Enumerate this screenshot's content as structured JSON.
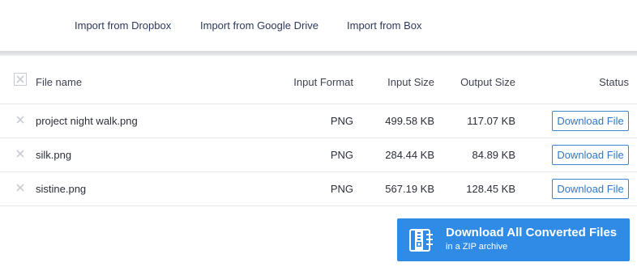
{
  "imports": {
    "dropbox": "Import from Dropbox",
    "gdrive": "Import from Google Drive",
    "box": "Import from Box"
  },
  "table": {
    "headers": {
      "file_name": "File name",
      "input_format": "Input Format",
      "input_size": "Input Size",
      "output_size": "Output Size",
      "status": "Status"
    },
    "rows": [
      {
        "name": "project night walk.png",
        "format": "PNG",
        "input_size": "499.58 KB",
        "output_size": "117.07 KB",
        "action": "Download File"
      },
      {
        "name": "silk.png",
        "format": "PNG",
        "input_size": "284.44 KB",
        "output_size": "84.89 KB",
        "action": "Download File"
      },
      {
        "name": "sistine.png",
        "format": "PNG",
        "input_size": "567.19 KB",
        "output_size": "128.45 KB",
        "action": "Download File"
      }
    ]
  },
  "download_all": {
    "title": "Download All Converted Files",
    "subtitle": "in a ZIP archive",
    "icon": "zip-archive-icon"
  },
  "colors": {
    "accent": "#2f8be6",
    "link": "#2d3a5c",
    "button_border": "#3a86d3"
  }
}
